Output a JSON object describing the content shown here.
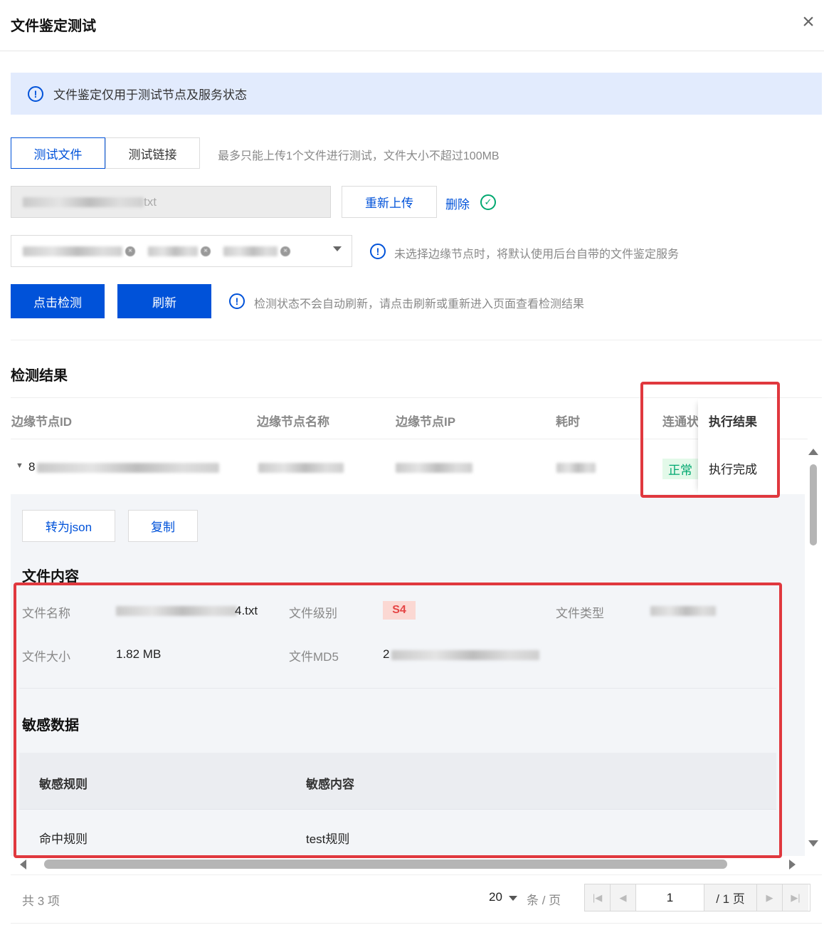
{
  "dialog": {
    "title": "文件鉴定测试",
    "close_glyph": "×"
  },
  "alert": {
    "text": "文件鉴定仅用于测试节点及服务状态",
    "icon": "!"
  },
  "tabs": [
    {
      "label": "测试文件"
    },
    {
      "label": "测试链接"
    }
  ],
  "upload": {
    "hint": "最多只能上传1个文件进行测试，文件大小不超过100MB",
    "file_suffix": "txt",
    "reupload_label": "重新上传",
    "delete_label": "删除",
    "check_glyph": "✓"
  },
  "node_select": {
    "hint": "未选择边缘节点时，将默认使用后台自带的文件鉴定服务",
    "chip_close_glyph": "×"
  },
  "actions": {
    "detect_label": "点击检测",
    "refresh_label": "刷新",
    "hint": "检测状态不会自动刷新，请点击刷新或重新进入页面查看检测结果"
  },
  "results": {
    "title": "检测结果",
    "columns": [
      "边缘节点ID",
      "边缘节点名称",
      "边缘节点IP",
      "耗时",
      "连通状",
      "执行结果"
    ],
    "row": {
      "expand_glyph": "▼",
      "id_prefix": "8",
      "status": "正常",
      "exec_result": "执行完成"
    },
    "detail": {
      "to_json_label": "转为json",
      "copy_label": "复制",
      "file_content_title": "文件内容",
      "file_name_label": "文件名称",
      "file_name_suffix": "4.txt",
      "file_level_label": "文件级别",
      "file_level": "S4",
      "file_type_label": "文件类型",
      "file_size_label": "文件大小",
      "file_size": "1.82 MB",
      "file_md5_label": "文件MD5",
      "file_md5_prefix": "2",
      "sensitive_title": "敏感数据",
      "sensitive_columns": [
        "敏感规则",
        "敏感内容"
      ],
      "sensitive_rows": [
        {
          "rule": "命中规则",
          "content": "test规则"
        }
      ]
    }
  },
  "pagination": {
    "total_text": "共 3 项",
    "page_size": "20",
    "page_size_unit": "条 / 页",
    "current_page": "1",
    "total_pages_text": "/ 1 页"
  },
  "colors": {
    "primary": "#0052d9",
    "success": "#00a870",
    "danger": "#e54545",
    "highlight": "#e0383e"
  }
}
